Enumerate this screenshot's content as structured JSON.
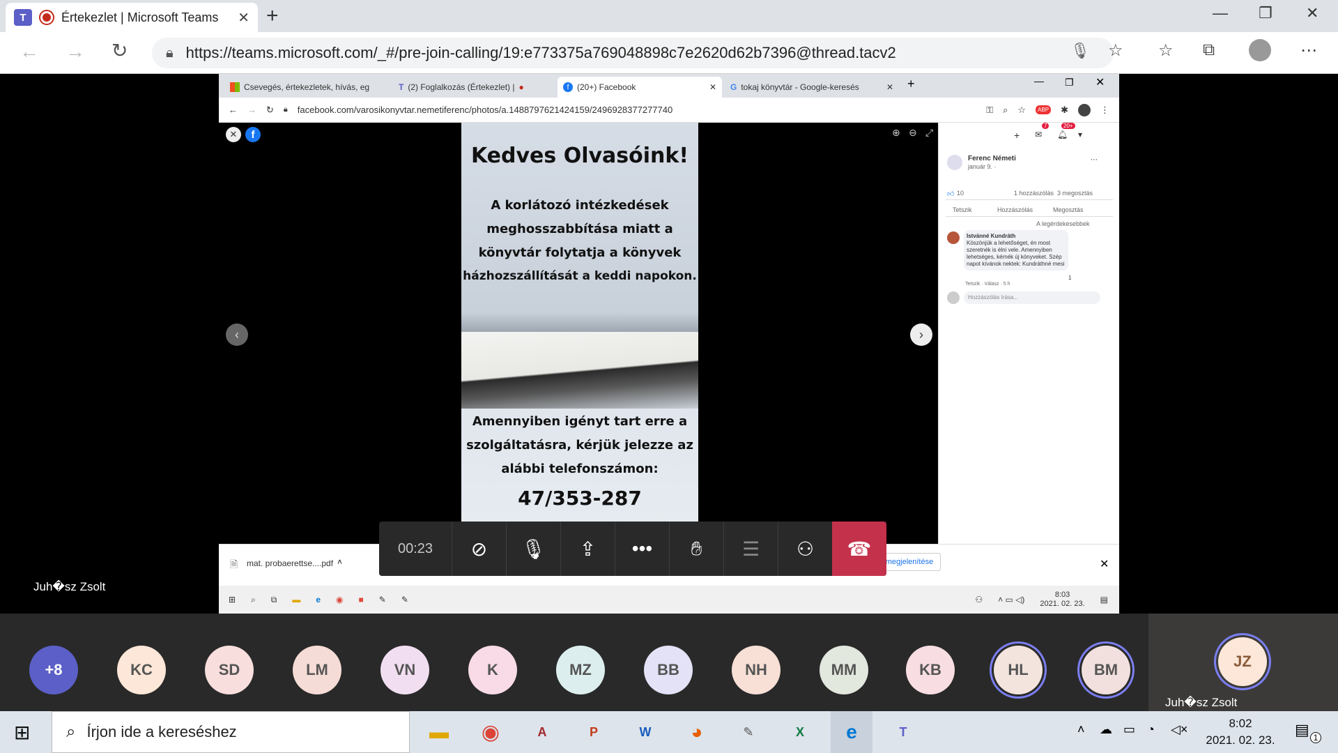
{
  "edge": {
    "tab_title": "Értekezlet | Microsoft Teams",
    "url": "https://teams.microsoft.com/_#/pre-join-calling/19:e773375a769048898c7e2620d62b7396@thread.tacv2"
  },
  "inner_browser": {
    "tabs": [
      "Csevegés, értekezletek, hívás, eg",
      "(2) Foglalkozás (Értekezlet) |",
      "(20+) Facebook",
      "tokaj könyvtár - Google-keresés"
    ],
    "url": "facebook.com/varosikonyvtar.nemetiferenc/photos/a.1488797621424159/2496928377277740"
  },
  "photo": {
    "title": "Kedves Olvasóink!",
    "line1": "A korlátozó intézkedések",
    "line2": "meghosszabbítása miatt a",
    "line3": "könyvtár folytatja a könyvek",
    "line4": "házhozszállítását a keddi napokon.",
    "line5": "Amennyiben igényt tart erre a",
    "line6": "szolgáltatásra, kérjük jelezze az",
    "line7": "alábbi telefonszámon:",
    "phone": "47/353-287"
  },
  "fb": {
    "messenger_badge": "7",
    "notif_badge": "20+",
    "author": "Ferenc Németi",
    "date": "január 9. ·",
    "likes": "10",
    "stats": "1 hozzászólás  3 megosztás",
    "like_btn": "Tetszik",
    "comment_btn": "Hozzászólás",
    "share_btn": "Megosztás",
    "sort": "A legérdekesebbek",
    "commenter": "Istvánné Kundráth",
    "comment": "Köszönjük a lehetőséget, én most szeretnék is élni vele. Amennyiben lehetséges, kérnék új könyveket. Szép napot kívánok nektek: Kundráthné mesi",
    "comment_meta": "Tetszik · Válasz · 5 h",
    "reaction_count": "1",
    "write_placeholder": "Hozzászólás írása..."
  },
  "download": {
    "file": "mat. probaerettse....pdf",
    "show_all": "Összes megjelenítése"
  },
  "inner_taskbar": {
    "time": "8:03",
    "date": "2021. 02. 23."
  },
  "call": {
    "timer": "00:23",
    "presenter": "Juh�sz Zsolt"
  },
  "participants": {
    "overflow": "+8",
    "list": [
      {
        "initials": "KC",
        "bg": "#fde7d8"
      },
      {
        "initials": "SD",
        "bg": "#f9dede"
      },
      {
        "initials": "LM",
        "bg": "#f6dcd6"
      },
      {
        "initials": "VN",
        "bg": "#f1dff1"
      },
      {
        "initials": "K",
        "bg": "#f8dbe6"
      },
      {
        "initials": "MZ",
        "bg": "#dcefee"
      },
      {
        "initials": "BB",
        "bg": "#e3e2f6"
      },
      {
        "initials": "NH",
        "bg": "#f8e0d6"
      },
      {
        "initials": "MM",
        "bg": "#e3e8df"
      },
      {
        "initials": "KB",
        "bg": "#f8dde2"
      },
      {
        "initials": "HL",
        "bg": "#f3e4dd"
      },
      {
        "initials": "BM",
        "bg": "#f1e0dd"
      }
    ],
    "me": {
      "initials": "JZ",
      "name": "Juh�sz Zsolt"
    }
  },
  "taskbar": {
    "search_placeholder": "Írjon ide a kereséshez",
    "time": "8:02",
    "date": "2021. 02. 23.",
    "notif_count": "1"
  },
  "colors": {
    "hangup": "#c4314b",
    "teams": "#5b5fc7",
    "overflow_avatar": "#5b5fc7",
    "active_ring": "#7b7ff0"
  }
}
